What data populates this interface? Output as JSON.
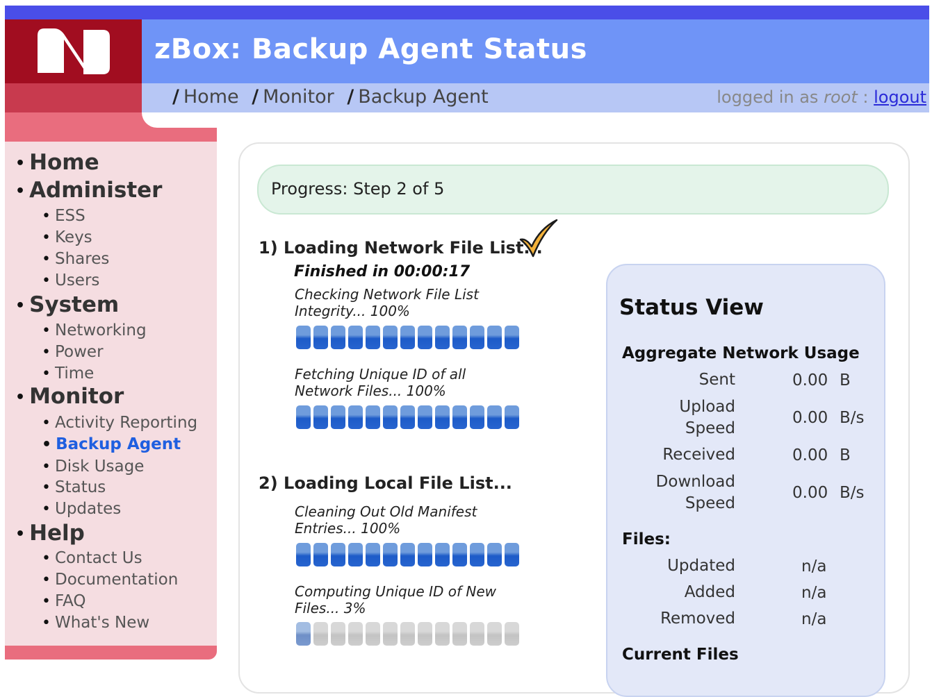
{
  "header": {
    "title": "zBox: Backup Agent Status",
    "breadcrumb": [
      "Home",
      "Monitor",
      "Backup Agent"
    ],
    "login_prefix": "logged in as",
    "user": "root",
    "login_sep": ":",
    "logout_label": "logout",
    "logo_icon": "zbox-logo-icon"
  },
  "sidebar": {
    "home": "Home",
    "administer": "Administer",
    "administer_items": [
      "ESS",
      "Keys",
      "Shares",
      "Users"
    ],
    "system": "System",
    "system_items": [
      "Networking",
      "Power",
      "Time"
    ],
    "monitor": "Monitor",
    "monitor_items": [
      "Activity Reporting",
      "Backup Agent",
      "Disk Usage",
      "Status",
      "Updates"
    ],
    "help": "Help",
    "help_items": [
      "Contact Us",
      "Documentation",
      "FAQ",
      "What's New"
    ],
    "active_item": "Backup Agent",
    "active_color": "#1f5fe0"
  },
  "progress": {
    "label": "Progress: Step 2 of 5",
    "current_step": 2,
    "total_steps": 5
  },
  "steps": [
    {
      "title": "1) Loading Network File List...",
      "finished": "Finished in 00:00:17",
      "tasks": [
        {
          "label": "Checking Network File List Integrity... 100%",
          "percent": 100
        },
        {
          "label": "Fetching Unique ID of all Network Files... 100%",
          "percent": 100
        }
      ]
    },
    {
      "title": "2) Loading Local File List...",
      "tasks": [
        {
          "label": "Cleaning Out Old Manifest Entries... 100%",
          "percent": 100
        },
        {
          "label": "Computing Unique ID of New Files... 3%",
          "percent": 3
        }
      ]
    }
  ],
  "status_view": {
    "title": "Status View",
    "network_heading": "Aggregate Network Usage",
    "network_rows": [
      {
        "label": "Sent",
        "value": "0.00",
        "unit": "B"
      },
      {
        "label": "Upload Speed",
        "value": "0.00",
        "unit": "B/s"
      },
      {
        "label": "Received",
        "value": "0.00",
        "unit": "B"
      },
      {
        "label": "Download Speed",
        "value": "0.00",
        "unit": "B/s"
      }
    ],
    "files_heading": "Files:",
    "files_rows": [
      {
        "label": "Updated",
        "value": "n/a"
      },
      {
        "label": "Added",
        "value": "n/a"
      },
      {
        "label": "Removed",
        "value": "n/a"
      }
    ],
    "current_files_heading": "Current Files"
  },
  "colors": {
    "top_strip": "#4a4ee8",
    "title_bar": "#6f94f7",
    "breadcrumb_bar": "#b7c7f5",
    "logo_bg": "#a10d20",
    "sidebar_bg": "#f5dde1",
    "sidebar_edge": "#e96d7e",
    "progress_bg": "#e4f4ea",
    "status_bg": "#e3e8f8",
    "bar_fill": "#1d5bc8"
  }
}
